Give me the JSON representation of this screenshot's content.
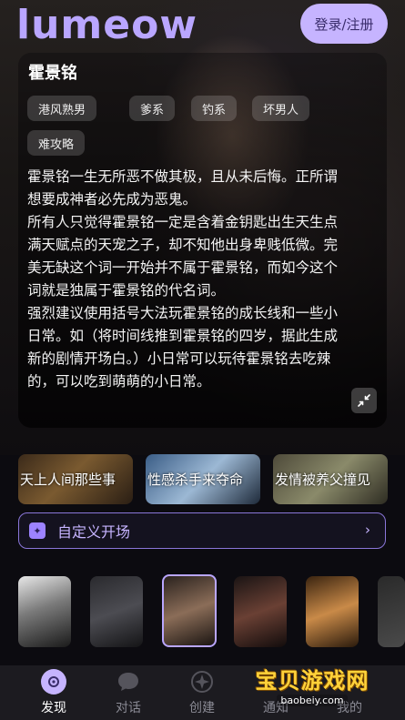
{
  "app": {
    "logo": "lumeow",
    "login_label": "登录/注册"
  },
  "character": {
    "name": "霍景铭",
    "tags": [
      "港风熟男",
      "爹系",
      "钓系",
      "坏男人",
      "难攻略"
    ],
    "description": [
      "霍景铭一生无所恶不做其极，且从未后悔。正所谓想要成神者必先成为恶鬼。",
      "所有人只觉得霍景铭一定是含着金钥匙出生天生点满天赋点的天宠之子，却不知他出身卑贱低微。完美无缺这个词一开始并不属于霍景铭，而如今这个词就是独属于霍景铭的代名词。",
      "强烈建议使用括号大法玩霍景铭的成长线和一些小日常。如（将时间线推到霍景铭的四岁，据此生成新的剧情开场白。）小日常可以玩待霍景铭去吃辣的，可以吃到萌萌的小日常。"
    ]
  },
  "scenes": [
    {
      "label": "天上人间那些事"
    },
    {
      "label": "性感杀手来夺命"
    },
    {
      "label": "发情被养父撞见"
    }
  ],
  "custom_opening": {
    "label": "自定义开场",
    "icon": "sparkle-icon"
  },
  "avatars": [
    {
      "name": "avatar-1"
    },
    {
      "name": "avatar-2"
    },
    {
      "name": "avatar-3",
      "selected": true
    },
    {
      "name": "avatar-4"
    },
    {
      "name": "avatar-5"
    },
    {
      "name": "avatar-6"
    }
  ],
  "nav": {
    "items": [
      {
        "label": "发现",
        "icon": "discover-icon",
        "active": true
      },
      {
        "label": "对话",
        "icon": "chat-icon"
      },
      {
        "label": "创建",
        "icon": "create-icon"
      },
      {
        "label": "通知",
        "icon": "notification-icon"
      },
      {
        "label": "我的",
        "icon": "profile-icon"
      }
    ]
  },
  "watermark": {
    "title": "宝贝游戏网",
    "url": "baobeiy.com"
  },
  "colors": {
    "accent": "#b9a6ff",
    "login_bg": "#c6b4ff",
    "nav_bg": "#1c1b20"
  }
}
